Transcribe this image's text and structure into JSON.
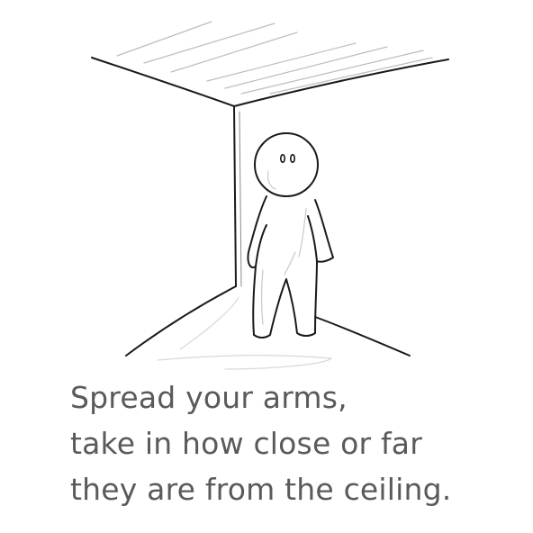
{
  "caption": {
    "lines": [
      "Spread your arms,",
      "take in how close or far",
      "they are from the ceiling."
    ]
  },
  "colors": {
    "line": "#1a1a1a",
    "shade": "#d9d9d9",
    "caption": "#5a5a5a",
    "background": "#ffffff"
  }
}
